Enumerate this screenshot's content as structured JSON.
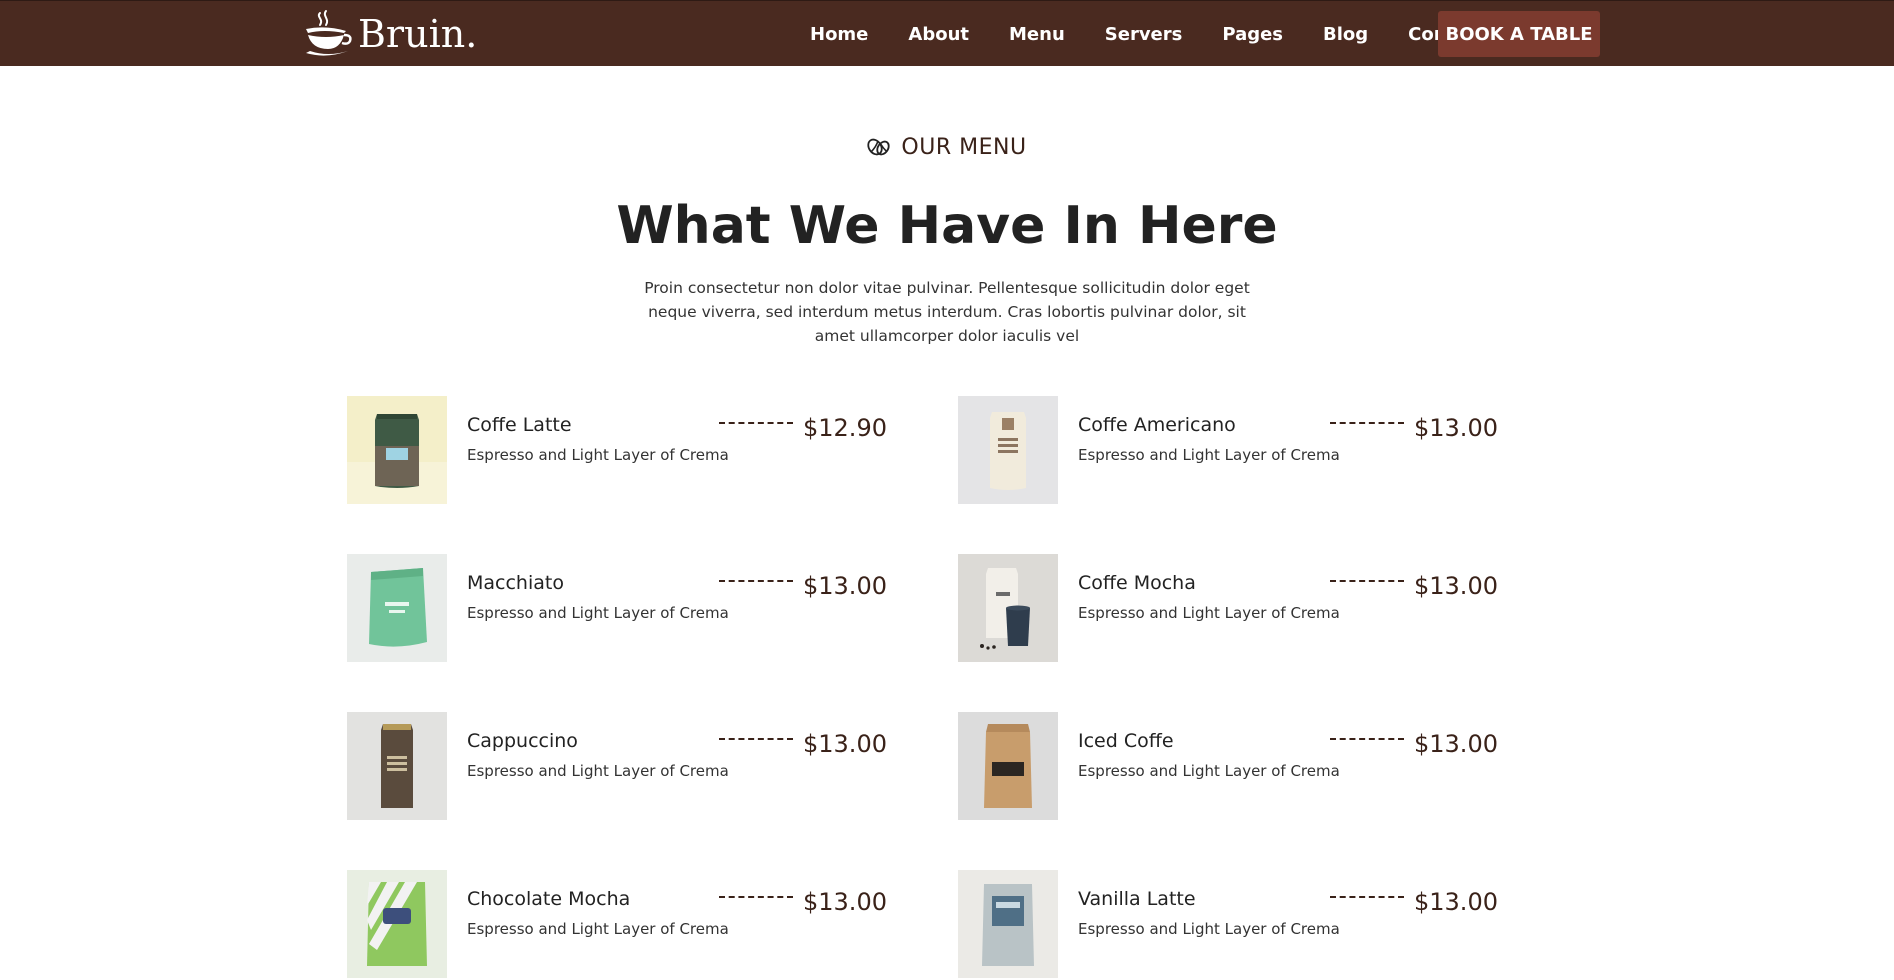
{
  "brand": {
    "name": "Bruin.",
    "logo_icon": "coffee-cup-steam-icon"
  },
  "nav": {
    "links": [
      "Home",
      "About",
      "Menu",
      "Servers",
      "Pages",
      "Blog",
      "Contact"
    ],
    "cta": "BOOK A TABLE"
  },
  "header": {
    "eyebrow": "OUR MENU",
    "eyebrow_icon": "coffee-bean-icon",
    "title": "What We Have In Here",
    "lead": "Proin consectetur non dolor vitae pulvinar. Pellentesque sollicitudin dolor eget neque viverra, sed interdum metus interdum. Cras lobortis pulvinar dolor, sit amet ullamcorper dolor iaculis vel"
  },
  "menu": {
    "dashes": "--------",
    "items": [
      {
        "name": "Coffe Latte",
        "desc": "Espresso and Light Layer of Crema",
        "price": "$12.90"
      },
      {
        "name": "Coffe Americano",
        "desc": "Espresso and Light Layer of Crema",
        "price": "$13.00"
      },
      {
        "name": "Macchiato",
        "desc": "Espresso and Light Layer of Crema",
        "price": "$13.00"
      },
      {
        "name": "Coffe Mocha",
        "desc": "Espresso and Light Layer of Crema",
        "price": "$13.00"
      },
      {
        "name": "Cappuccino",
        "desc": "Espresso and Light Layer of Crema",
        "price": "$13.00"
      },
      {
        "name": "Iced Coffe",
        "desc": "Espresso and Light Layer of Crema",
        "price": "$13.00"
      },
      {
        "name": "Chocolate Mocha",
        "desc": "Espresso and Light Layer of Crema",
        "price": "$13.00"
      },
      {
        "name": "Vanilla Latte",
        "desc": "Espresso and Light Layer of Crema",
        "price": "$13.00"
      }
    ]
  },
  "colors": {
    "nav_bg": "#4a2a20",
    "cta_bg": "#7b3a2e",
    "price_text": "#3a2219"
  }
}
